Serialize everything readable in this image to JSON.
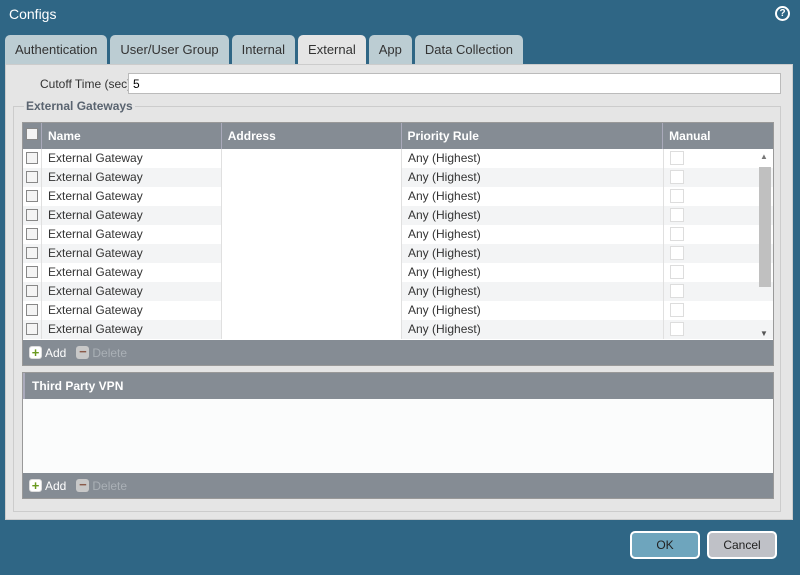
{
  "title": "Configs",
  "tabs": [
    {
      "label": "Authentication"
    },
    {
      "label": "User/User Group"
    },
    {
      "label": "Internal"
    },
    {
      "label": "External",
      "active": true
    },
    {
      "label": "App"
    },
    {
      "label": "Data Collection"
    }
  ],
  "cutoff": {
    "label": "Cutoff Time (sec)",
    "value": "5"
  },
  "gateways": {
    "legend": "External Gateways",
    "columns": [
      "Name",
      "Address",
      "Priority Rule",
      "Manual"
    ],
    "rows": [
      {
        "name": "External Gateway",
        "address": "",
        "priority": "Any (Highest)"
      },
      {
        "name": "External Gateway",
        "address": "",
        "priority": "Any (Highest)"
      },
      {
        "name": "External Gateway",
        "address": "",
        "priority": "Any (Highest)"
      },
      {
        "name": "External Gateway",
        "address": "",
        "priority": "Any (Highest)"
      },
      {
        "name": "External Gateway",
        "address": "",
        "priority": "Any (Highest)"
      },
      {
        "name": "External Gateway",
        "address": "",
        "priority": "Any (Highest)"
      },
      {
        "name": "External Gateway",
        "address": "",
        "priority": "Any (Highest)"
      },
      {
        "name": "External Gateway",
        "address": "",
        "priority": "Any (Highest)"
      },
      {
        "name": "External Gateway",
        "address": "",
        "priority": "Any (Highest)"
      },
      {
        "name": "External Gateway",
        "address": "",
        "priority": "Any (Highest)"
      }
    ],
    "add": "Add",
    "delete": "Delete"
  },
  "third_party": {
    "header": "Third Party VPN",
    "add": "Add",
    "delete": "Delete"
  },
  "buttons": {
    "ok": "OK",
    "cancel": "Cancel"
  }
}
